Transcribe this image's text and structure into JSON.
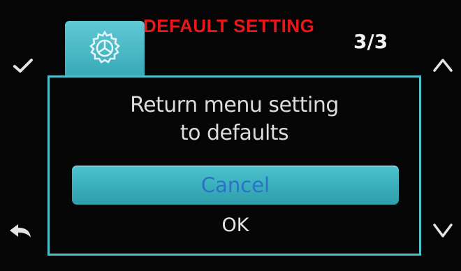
{
  "header": {
    "title": "DEFAULT SETTING",
    "page_indicator": "3/3",
    "tab_icon": "gear-icon"
  },
  "dialog": {
    "message_line1": "Return menu setting",
    "message_line2": "to defaults",
    "options": [
      {
        "label": "Cancel",
        "selected": true
      },
      {
        "label": "OK",
        "selected": false
      }
    ]
  },
  "side_buttons": {
    "left_top": "check-icon",
    "left_bottom": "back-arrow-icon",
    "right_top": "chevron-up-icon",
    "right_bottom": "chevron-down-icon"
  },
  "colors": {
    "accent": "#4cc0cc",
    "title": "#e8181a",
    "selected_text": "#2a72c7",
    "background": "#050505"
  }
}
